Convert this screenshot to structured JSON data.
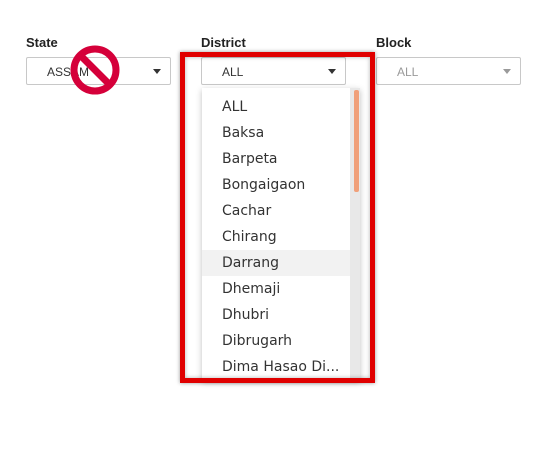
{
  "filters": {
    "state": {
      "label": "State",
      "value": "ASSAM"
    },
    "district": {
      "label": "District",
      "value": "ALL"
    },
    "block": {
      "label": "Block",
      "value": "ALL"
    }
  },
  "district_dropdown": {
    "options": [
      "ALL",
      "Baksa",
      "Barpeta",
      "Bongaigaon",
      "Cachar",
      "Chirang",
      "Darrang",
      "Dhemaji",
      "Dhubri",
      "Dibrugarh",
      "Dima Hasao Di..."
    ],
    "hovered_option": "Darrang"
  },
  "icons": {
    "blocked": "no-entry-sign-icon",
    "caret": "chevron-down-icon"
  },
  "colors": {
    "highlight": "#e00000",
    "no_sign": "#d5003a",
    "scroll_thumb": "#f0a07a"
  }
}
